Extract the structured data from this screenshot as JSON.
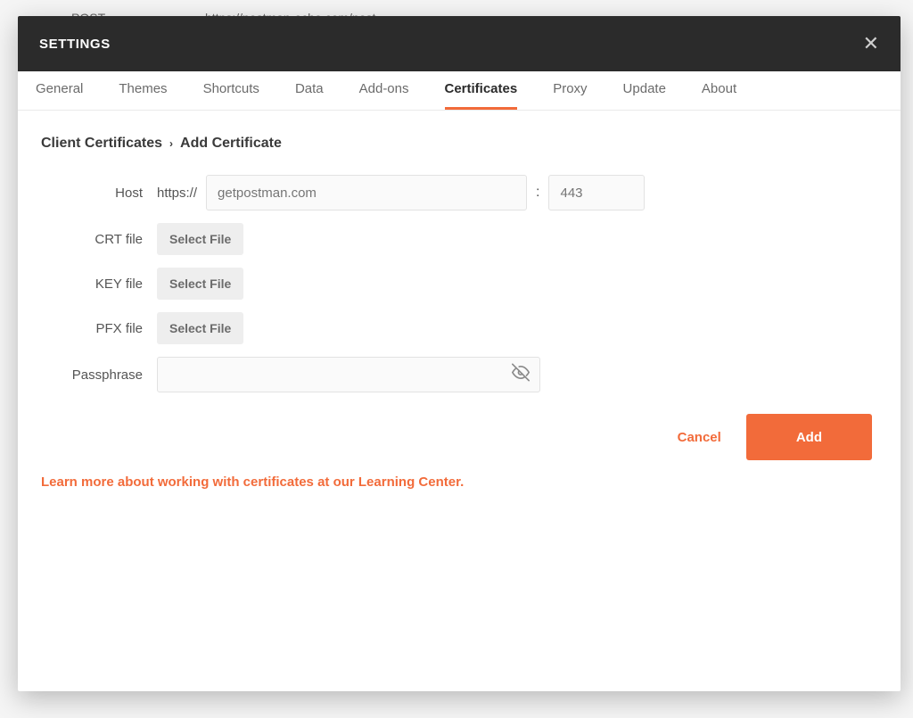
{
  "background": {
    "method": "POST",
    "url_fragment": "https://postman-echo.com/post"
  },
  "modal": {
    "title": "SETTINGS"
  },
  "tabs": {
    "general": "General",
    "themes": "Themes",
    "shortcuts": "Shortcuts",
    "data": "Data",
    "addons": "Add-ons",
    "certificates": "Certificates",
    "proxy": "Proxy",
    "update": "Update",
    "about": "About",
    "active": "certificates"
  },
  "breadcrumb": {
    "root": "Client Certificates",
    "leaf": "Add Certificate"
  },
  "form": {
    "host_label": "Host",
    "host_protocol": "https://",
    "host_placeholder": "getpostman.com",
    "host_value": "",
    "port_placeholder": "443",
    "port_value": "",
    "crt_label": "CRT file",
    "key_label": "KEY file",
    "pfx_label": "PFX file",
    "select_file": "Select File",
    "passphrase_label": "Passphrase",
    "passphrase_value": ""
  },
  "actions": {
    "cancel": "Cancel",
    "add": "Add"
  },
  "help": {
    "learn_more": "Learn more about working with certificates at our Learning Center."
  }
}
